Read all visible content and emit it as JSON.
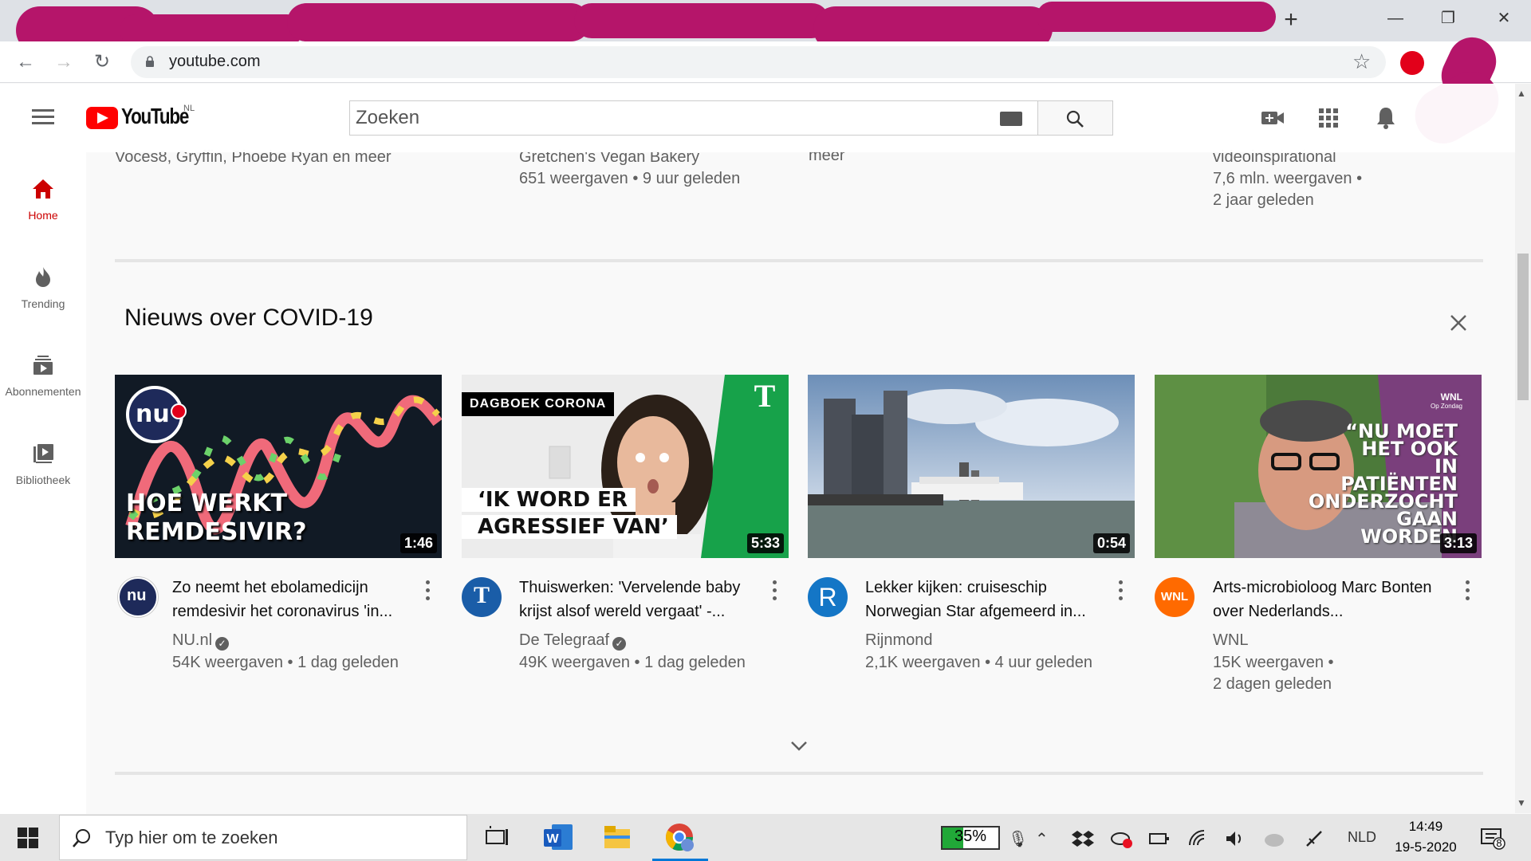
{
  "browser": {
    "url": "youtube.com",
    "new_tab_label": "+",
    "minimize_label": "—",
    "maximize_label": "❐",
    "close_label": "✕"
  },
  "header": {
    "logo_text": "YouTube",
    "country_code": "NL",
    "search_placeholder": "Zoeken"
  },
  "sidebar": {
    "items": [
      {
        "label": "Home",
        "icon": "home-icon",
        "active": true
      },
      {
        "label": "Trending",
        "icon": "trending-icon",
        "active": false
      },
      {
        "label": "Abonnementen",
        "icon": "subscriptions-icon",
        "active": false
      },
      {
        "label": "Bibliotheek",
        "icon": "library-icon",
        "active": false
      }
    ]
  },
  "previous_row": {
    "col1": {
      "line1": "Voces8, Gryffin, Phoebe Ryan en meer"
    },
    "col2": {
      "line1": "Gretchen's Vegan Bakery",
      "line2": "651 weergaven • 9 uur geleden"
    },
    "col3": {
      "line1": "meer"
    },
    "col4": {
      "line1": "videoinspirational",
      "line2": "7,6 mln. weergaven •",
      "line3": "2 jaar geleden"
    }
  },
  "section": {
    "title": "Nieuws over COVID-19"
  },
  "videos": [
    {
      "title_line1": "Zo neemt het ebolamedicijn",
      "title_line2": "remdesivir het coronavirus 'in...",
      "channel": "NU.nl",
      "verified": true,
      "stats_line1": "54K weergaven • 1 dag geleden",
      "stats_line2": "",
      "duration": "1:46",
      "thumb_text1": "HOE WERKT",
      "thumb_text2": "REMDESIVIR?",
      "avatar_text": "nu"
    },
    {
      "title_line1": "Thuiswerken: 'Vervelende baby",
      "title_line2": "krijst alsof wereld vergaat' -...",
      "channel": "De Telegraaf",
      "verified": true,
      "stats_line1": "49K weergaven • 1 dag geleden",
      "stats_line2": "",
      "duration": "5:33",
      "thumb_tag": "DAGBOEK CORONA",
      "thumb_text1": "‘IK WORD ER",
      "thumb_text2": "AGRESSIEF VAN’",
      "avatar_text": "T"
    },
    {
      "title_line1": "Lekker kijken: cruiseschip",
      "title_line2": "Norwegian Star afgemeerd in...",
      "channel": "Rijnmond",
      "verified": false,
      "stats_line1": "2,1K weergaven • 4 uur geleden",
      "stats_line2": "",
      "duration": "0:54",
      "avatar_text": "R"
    },
    {
      "title_line1": "Arts-microbioloog Marc Bonten",
      "title_line2": "over Nederlands...",
      "channel": "WNL",
      "verified": false,
      "stats_line1": "15K weergaven •",
      "stats_line2": "2 dagen geleden",
      "duration": "3:13",
      "thumb_brand": "WNL",
      "thumb_brand_sub": "Op Zondag",
      "thumb_quote": [
        "“NU MOET",
        "HET OOK",
        "IN",
        "PATIËNTEN",
        "ONDERZOCHT",
        "GAAN",
        "WORDEN"
      ],
      "avatar_text": "WNL"
    }
  ],
  "taskbar": {
    "search_placeholder": "Typ hier om te zoeken",
    "battery": "35%",
    "language": "NLD",
    "time": "14:49",
    "date": "19-5-2020",
    "notifications": "8"
  },
  "colors": {
    "youtube_red": "#ff0000",
    "scribble": "#b5156a",
    "battery_green": "#21a838"
  }
}
